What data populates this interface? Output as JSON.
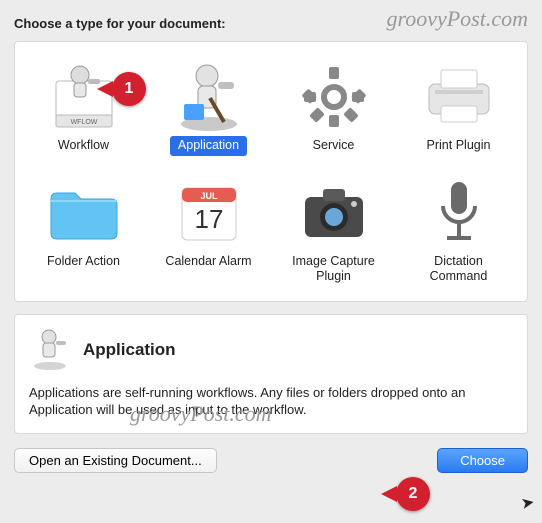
{
  "watermark": "groovyPost.com",
  "heading": "Choose a type for your document:",
  "types": [
    {
      "label": "Workflow",
      "icon": "workflow-icon",
      "selected": false
    },
    {
      "label": "Application",
      "icon": "application-icon",
      "selected": true
    },
    {
      "label": "Service",
      "icon": "service-icon",
      "selected": false
    },
    {
      "label": "Print Plugin",
      "icon": "print-plugin-icon",
      "selected": false
    },
    {
      "label": "Folder Action",
      "icon": "folder-action-icon",
      "selected": false
    },
    {
      "label": "Calendar Alarm",
      "icon": "calendar-icon",
      "selected": false
    },
    {
      "label": "Image Capture\nPlugin",
      "icon": "image-capture-icon",
      "selected": false
    },
    {
      "label": "Dictation\nCommand",
      "icon": "dictation-icon",
      "selected": false
    }
  ],
  "description": {
    "title": "Application",
    "body": "Applications are self-running workflows. Any files or folders dropped onto an Application will be used as input to the workflow."
  },
  "buttons": {
    "open": "Open an Existing Document...",
    "choose": "Choose"
  },
  "callouts": {
    "one": "1",
    "two": "2"
  },
  "calendar_day": "17",
  "calendar_month": "JUL",
  "wflow_badge": "WFLOW"
}
